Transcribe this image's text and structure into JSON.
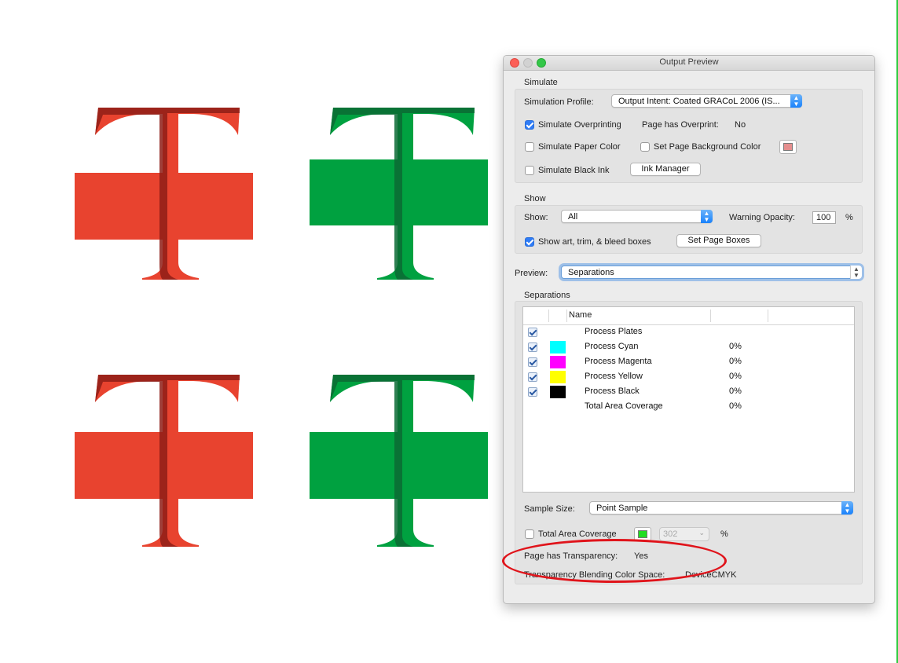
{
  "window": {
    "title": "Output Preview"
  },
  "simulate": {
    "section_label": "Simulate",
    "profile_label": "Simulation Profile:",
    "profile_value": "Output Intent: Coated GRACoL 2006 (IS...",
    "overprint_label": "Simulate Overprinting",
    "overprint_checked": true,
    "page_has_overprint_label": "Page has Overprint:",
    "page_has_overprint_value": "No",
    "paper_color_label": "Simulate Paper Color",
    "page_bg_label": "Set Page Background Color",
    "page_bg_color": "#e58e8e",
    "black_ink_label": "Simulate Black Ink",
    "ink_manager_label": "Ink Manager"
  },
  "show": {
    "section_label": "Show",
    "show_label": "Show:",
    "show_value": "All",
    "warning_opacity_label": "Warning Opacity:",
    "warning_opacity_value": "100",
    "percent_sign": "%",
    "boxes_label": "Show art, trim, & bleed boxes",
    "boxes_checked": true,
    "set_page_boxes_label": "Set Page Boxes"
  },
  "preview": {
    "label": "Preview:",
    "value": "Separations"
  },
  "separations": {
    "section_label": "Separations",
    "name_header": "Name",
    "rows": [
      {
        "name": "Process Plates",
        "percent": "",
        "color": "",
        "checked": true
      },
      {
        "name": "Process Cyan",
        "percent": "0%",
        "color": "#00ffff",
        "checked": true
      },
      {
        "name": "Process Magenta",
        "percent": "0%",
        "color": "#ff00ff",
        "checked": true
      },
      {
        "name": "Process Yellow",
        "percent": "0%",
        "color": "#ffff00",
        "checked": true
      },
      {
        "name": "Process Black",
        "percent": "0%",
        "color": "#000000",
        "checked": true
      },
      {
        "name": "Total Area Coverage",
        "percent": "0%",
        "color": "",
        "checked": false
      }
    ],
    "sample_size_label": "Sample Size:",
    "sample_size_value": "Point Sample",
    "tac_label": "Total Area Coverage",
    "tac_color": "#22dd22",
    "tac_value": "302",
    "tac_percent": "%",
    "transparency_label": "Page has Transparency:",
    "transparency_value": "Yes",
    "blending_label": "Transparency Blending Color Space:",
    "blending_value": "DeviceCMYK"
  },
  "colors": {
    "red": "#e8432f",
    "red_dark": "#8e1d16",
    "green": "#00a140",
    "green_dark": "#0b6a34",
    "annotation": "#e0141b"
  }
}
